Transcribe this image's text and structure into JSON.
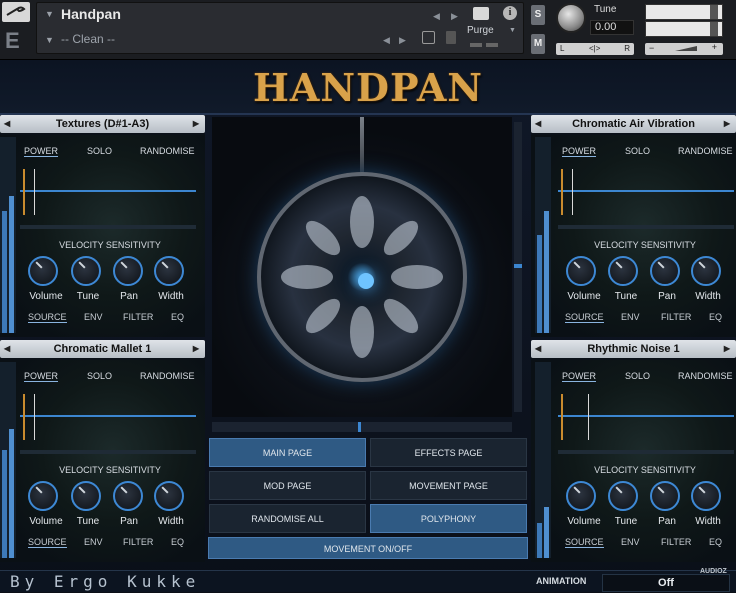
{
  "header": {
    "instrument_name": "Handpan",
    "preset": "-- Clean --",
    "purge_label": "Purge",
    "s_label": "S",
    "m_label": "M",
    "tune_label": "Tune",
    "tune_value": "0.00",
    "pan_left": "L",
    "pan_right": "R",
    "pan_center": "<|>",
    "vol_minus": "−",
    "vol_plus": "+",
    "info_label": "i",
    "logo_letter": "E"
  },
  "title": "HANDPAN",
  "panel_common": {
    "power": "POWER",
    "solo": "SOLO",
    "randomise": "RANDOMISE",
    "velocity": "VELOCITY SENSITIVITY",
    "knobs": [
      "Volume",
      "Tune",
      "Pan",
      "Width"
    ],
    "subtabs": [
      "SOURCE",
      "ENV",
      "FILTER",
      "EQ"
    ]
  },
  "panels": [
    {
      "name": "Textures (D#1-A3)",
      "meter_left": 0.62,
      "meter_right": 0.7
    },
    {
      "name": "Chromatic Air Vibration",
      "meter_left": 0.5,
      "meter_right": 0.62
    },
    {
      "name": "Chromatic Mallet 1",
      "meter_left": 0.55,
      "meter_right": 0.66
    },
    {
      "name": "Rhythmic Noise 1",
      "meter_left": 0.18,
      "meter_right": 0.26
    }
  ],
  "buttons": {
    "main_page": "MAIN PAGE",
    "effects_page": "EFFECTS PAGE",
    "mod_page": "MOD PAGE",
    "movement_page": "MOVEMENT PAGE",
    "randomise_all": "RANDOMISE ALL",
    "polyphony": "POLYPHONY",
    "movement_onoff": "MOVEMENT ON/OFF"
  },
  "footer": {
    "credit": "By Ergo Kukke",
    "animation_label": "ANIMATION",
    "animation_value": "Off"
  },
  "watermark": "AUDIOZ",
  "colors": {
    "accent": "#3c86d0",
    "title_gold": "#d9a24a",
    "active_button": "#2f5a84"
  }
}
